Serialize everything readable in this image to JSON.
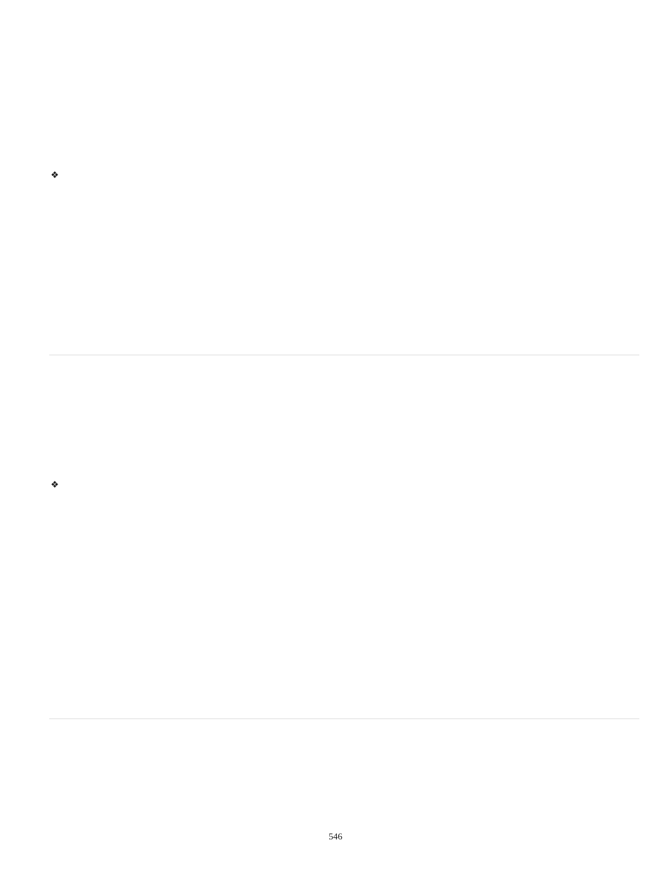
{
  "ornament_glyph": "❖",
  "page_number": "546"
}
